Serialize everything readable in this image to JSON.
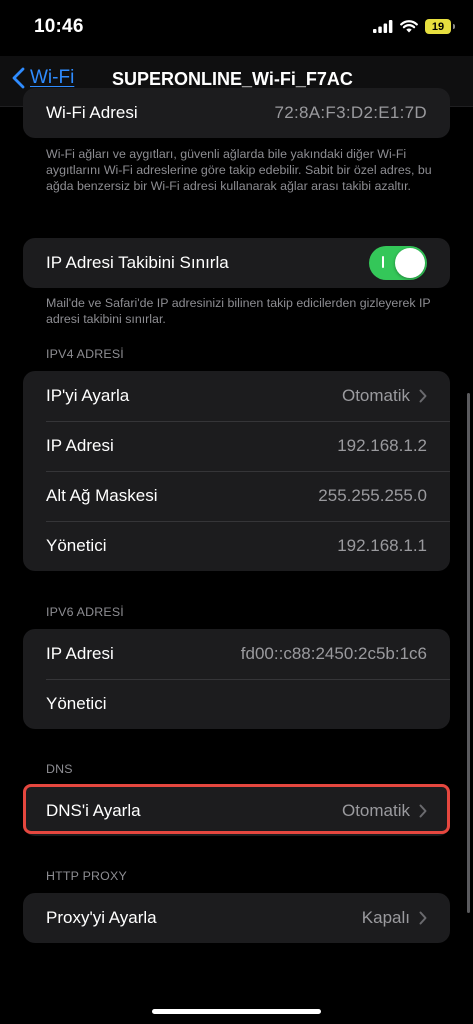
{
  "status_bar": {
    "time": "10:46",
    "battery": "19"
  },
  "nav": {
    "back_label": "Wi-Fi",
    "title": "SUPERONLINE_Wi-Fi_F7AC"
  },
  "wifi_address": {
    "label": "Wi-Fi Adresi",
    "value": "72:8A:F3:D2:E1:7D",
    "footnote": "Wi-Fi ağları ve aygıtları, güvenli ağlarda bile yakındaki diğer Wi-Fi aygıtlarını Wi-Fi adreslerine göre takip edebilir. Sabit bir özel adres, bu ağda benzersiz bir Wi-Fi adresi kullanarak ağlar arası takibi azaltır."
  },
  "ip_tracking": {
    "label": "IP Adresi Takibini Sınırla",
    "enabled": true,
    "footnote": "Mail'de ve Safari'de IP adresinizi bilinen takip edicilerden gizleyerek IP adresi takibini sınırlar."
  },
  "ipv4": {
    "header": "IPV4 ADRESİ",
    "rows": [
      {
        "label": "IP'yi Ayarla",
        "value": "Otomatik"
      },
      {
        "label": "IP Adresi",
        "value": "192.168.1.2"
      },
      {
        "label": "Alt Ağ Maskesi",
        "value": "255.255.255.0"
      },
      {
        "label": "Yönetici",
        "value": "192.168.1.1"
      }
    ]
  },
  "ipv6": {
    "header": "IPV6 ADRESİ",
    "rows": [
      {
        "label": "IP Adresi",
        "value": "fd00::c88:2450:2c5b:1c6"
      },
      {
        "label": "Yönetici",
        "value": ""
      }
    ]
  },
  "dns": {
    "header": "DNS",
    "label": "DNS'i Ayarla",
    "value": "Otomatik"
  },
  "proxy": {
    "header": "HTTP PROXY",
    "label": "Proxy'yi Ayarla",
    "value": "Kapalı"
  },
  "colors": {
    "accent": "#2f8cff",
    "toggle_on": "#34c759",
    "highlight": "#e5473f"
  }
}
